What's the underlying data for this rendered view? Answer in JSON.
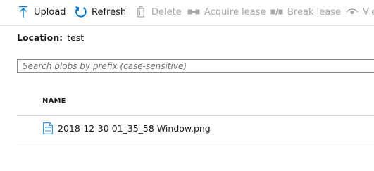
{
  "toolbar": {
    "upload": "Upload",
    "refresh": "Refresh",
    "delete": "Delete",
    "acquire_lease": "Acquire lease",
    "break_lease": "Break lease",
    "view": "View"
  },
  "location": {
    "label": "Location:",
    "value": "test"
  },
  "search": {
    "placeholder": "Search blobs by prefix (case-sensitive)",
    "value": ""
  },
  "table": {
    "columns": [
      "NAME"
    ],
    "rows": [
      {
        "name": "2018-12-30 01_35_58-Window.png"
      }
    ]
  },
  "colors": {
    "accent": "#0078d4",
    "disabled": "#a6a6a6",
    "file_icon": "#3a96dd"
  }
}
